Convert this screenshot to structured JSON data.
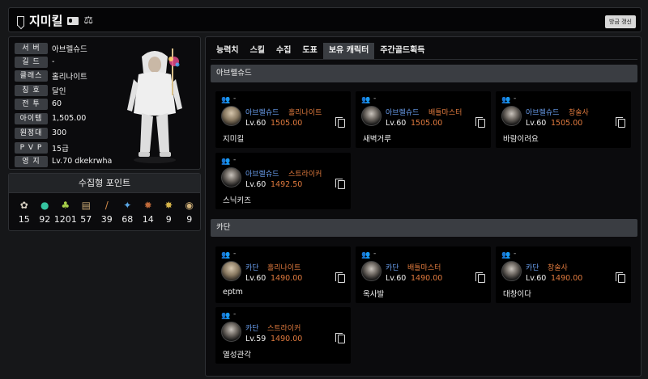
{
  "header": {
    "name": "지미킬",
    "refresh_label": "방금 갱신"
  },
  "profile": {
    "rows": [
      {
        "label": "서 버",
        "value": "아브렐슈드"
      },
      {
        "label": "길 드",
        "value": "-"
      },
      {
        "label": "클래스",
        "value": "홀리나이트"
      },
      {
        "label": "칭 호",
        "value": "달인"
      },
      {
        "label": "전 투",
        "value": "60"
      },
      {
        "label": "아이템",
        "value": "1,505.00"
      },
      {
        "label": "원정대",
        "value": "300"
      },
      {
        "label": "P V P",
        "value": "15급"
      },
      {
        "label": "영 지",
        "value": "Lv.70 dkekrwha"
      }
    ]
  },
  "collection": {
    "title": "수집형 포인트",
    "items": [
      {
        "icon": "seed-icon",
        "glyph": "✿",
        "color": "#d9d2c4",
        "value": "15"
      },
      {
        "icon": "island-heart-icon",
        "glyph": "●",
        "color": "#35c4a0",
        "value": "92"
      },
      {
        "icon": "mokoko-seed-icon",
        "glyph": "♣",
        "color": "#a8d14a",
        "value": "1201"
      },
      {
        "icon": "art-map-icon",
        "glyph": "▤",
        "color": "#c9a873",
        "value": "57"
      },
      {
        "icon": "adventure-book-icon",
        "glyph": "/",
        "color": "#d48c4a",
        "value": "39"
      },
      {
        "icon": "giant-heart-icon",
        "glyph": "✦",
        "color": "#5aa7e6",
        "value": "68"
      },
      {
        "icon": "ignea-token-icon",
        "glyph": "✹",
        "color": "#c06a3a",
        "value": "14"
      },
      {
        "icon": "orpheus-star-icon",
        "glyph": "✸",
        "color": "#d8b64a",
        "value": "9"
      },
      {
        "icon": "world-tree-leaf-icon",
        "glyph": "◉",
        "color": "#d2b27a",
        "value": "9"
      }
    ]
  },
  "tabs": [
    "능력치",
    "스킬",
    "수집",
    "도표",
    "보유 캐릭터",
    "주간골드획득"
  ],
  "active_tab": "보유 캐릭터",
  "servers": [
    {
      "name": "아브렐슈드",
      "characters": [
        {
          "group": "-",
          "server": "아브렐슈드",
          "class": "홀리나이트",
          "level": "Lv.60",
          "item_level": "1505.00",
          "name": "지미킬",
          "face": "light"
        },
        {
          "group": "-",
          "server": "아브렐슈드",
          "class": "배틀마스터",
          "level": "Lv.60",
          "item_level": "1505.00",
          "name": "새벽거루",
          "face": "dark"
        },
        {
          "group": "-",
          "server": "아브렐슈드",
          "class": "창술사",
          "level": "Lv.60",
          "item_level": "1505.00",
          "name": "바람이려요",
          "face": "dark"
        },
        {
          "group": "-",
          "server": "아브렐슈드",
          "class": "스트라이커",
          "level": "Lv.60",
          "item_level": "1492.50",
          "name": "스닉키즈",
          "face": "dark"
        }
      ]
    },
    {
      "name": "카단",
      "characters": [
        {
          "group": "-",
          "server": "카단",
          "class": "홀리나이트",
          "level": "Lv.60",
          "item_level": "1490.00",
          "name": "eptm",
          "face": "light"
        },
        {
          "group": "-",
          "server": "카단",
          "class": "배틀마스터",
          "level": "Lv.60",
          "item_level": "1490.00",
          "name": "옥사발",
          "face": "dark"
        },
        {
          "group": "-",
          "server": "카단",
          "class": "창술사",
          "level": "Lv.60",
          "item_level": "1490.00",
          "name": "대창이다",
          "face": "dark"
        },
        {
          "group": "-",
          "server": "카단",
          "class": "스트라이커",
          "level": "Lv.59",
          "item_level": "1490.00",
          "name": "열성관각",
          "face": "dark"
        }
      ]
    }
  ]
}
